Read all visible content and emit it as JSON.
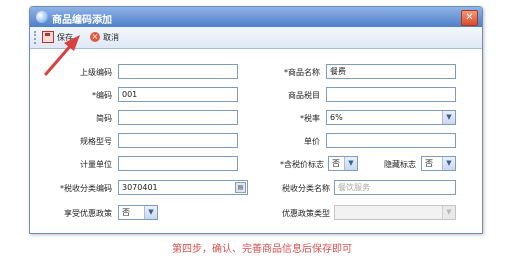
{
  "window": {
    "title": "商品编码添加",
    "close_glyph": "✕"
  },
  "toolbar": {
    "save_label": "保存",
    "cancel_label": "取消",
    "cancel_glyph": "×"
  },
  "form": {
    "parent_code": {
      "label": "上级编码",
      "value": ""
    },
    "goods_name": {
      "label": "*商品名称",
      "value": "餐费"
    },
    "code": {
      "label": "*编码",
      "value": "001"
    },
    "goods_tax_item": {
      "label": "商品税目",
      "value": ""
    },
    "short_code": {
      "label": "简码",
      "value": ""
    },
    "tax_rate": {
      "label": "*税率",
      "value": "6%"
    },
    "spec_model": {
      "label": "规格型号",
      "value": ""
    },
    "unit_price": {
      "label": "单价",
      "value": ""
    },
    "unit": {
      "label": "计量单位",
      "value": ""
    },
    "tax_included_flag": {
      "label": "*含税价标志",
      "value": "否"
    },
    "hidden_flag": {
      "label": "隐藏标志",
      "value": "否"
    },
    "tax_class_code": {
      "label": "*税收分类编码",
      "value": "3070401",
      "button_glyph": "▤"
    },
    "tax_class_name": {
      "label": "税收分类名称",
      "value": "餐饮服务"
    },
    "preferential_policy": {
      "label": "享受优惠政策",
      "value": "否"
    },
    "preferential_policy_type": {
      "label": "优惠政策类型",
      "value": ""
    },
    "dropdown_glyph": "▼"
  },
  "caption": "第四步，确认、完善商品信息后保存即可",
  "colors": {
    "annotation_arrow": "#d94040",
    "caption": "#d85050",
    "titlebar": "#4f7fc9"
  }
}
